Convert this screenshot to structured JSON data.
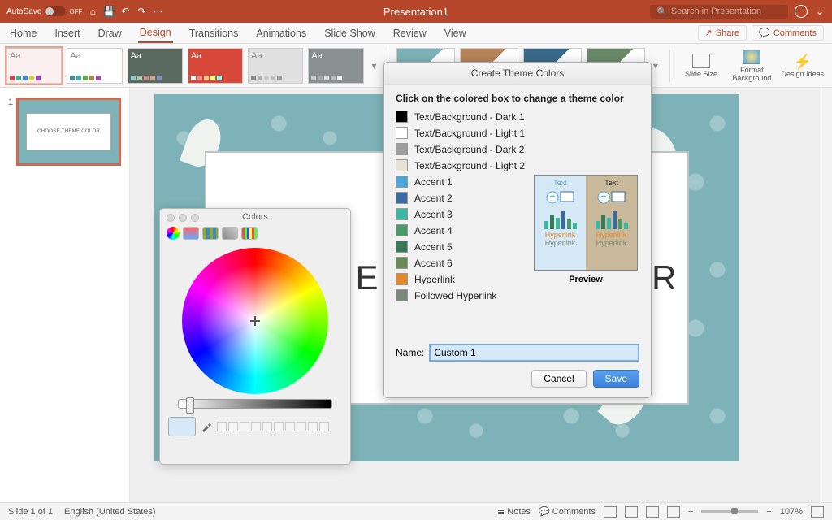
{
  "titlebar": {
    "autosave_label": "AutoSave",
    "autosave_state": "OFF",
    "title": "Presentation1",
    "search_placeholder": "Search in Presentation"
  },
  "tabs": {
    "items": [
      "Home",
      "Insert",
      "Draw",
      "Design",
      "Transitions",
      "Animations",
      "Slide Show",
      "Review",
      "View"
    ],
    "active_index": 3,
    "share": "Share",
    "comments": "Comments"
  },
  "ribbon_tools": {
    "slide_size": "Slide Size",
    "format_bg": "Format Background",
    "design_ideas": "Design Ideas"
  },
  "thumb": {
    "number": "1",
    "caption": "CHOOSE THEME COLOR"
  },
  "slide": {
    "title": "CHOOSE THEME COLOR"
  },
  "status": {
    "slide": "Slide 1 of 1",
    "lang": "English (United States)",
    "notes": "Notes",
    "comments": "Comments",
    "zoom": "107%"
  },
  "dialog": {
    "title": "Create Theme Colors",
    "instruction": "Click on the colored box to change a theme color",
    "items": [
      {
        "label": "Text/Background - Dark 1",
        "color": "#000000"
      },
      {
        "label": "Text/Background - Light 1",
        "color": "#ffffff"
      },
      {
        "label": "Text/Background - Dark 2",
        "color": "#9e9e9e"
      },
      {
        "label": "Text/Background - Light 2",
        "color": "#e8e2d5"
      },
      {
        "label": "Accent 1",
        "color": "#4aa8d8"
      },
      {
        "label": "Accent 2",
        "color": "#3a6aa0"
      },
      {
        "label": "Accent 3",
        "color": "#3eb5a0"
      },
      {
        "label": "Accent 4",
        "color": "#4a9b6a"
      },
      {
        "label": "Accent 5",
        "color": "#3a7a5a"
      },
      {
        "label": "Accent 6",
        "color": "#6a8a5a"
      },
      {
        "label": "Hyperlink",
        "color": "#e08a2a"
      },
      {
        "label": "Followed Hyperlink",
        "color": "#7a8a7a"
      }
    ],
    "preview_text": "Text",
    "preview_hyper": "Hyperlink",
    "preview_label": "Preview",
    "name_label": "Name:",
    "name_value": "Custom 1",
    "cancel": "Cancel",
    "save": "Save"
  },
  "colors_panel": {
    "title": "Colors"
  }
}
